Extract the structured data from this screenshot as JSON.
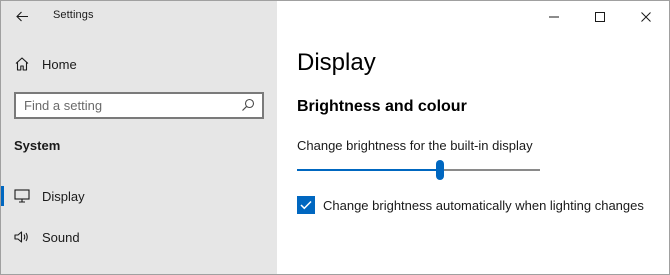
{
  "window": {
    "app_title": "Settings",
    "controls": [
      "minimize-icon",
      "maximize-icon",
      "close-icon"
    ]
  },
  "sidebar": {
    "home_label": "Home",
    "search": {
      "placeholder": "Find a setting",
      "value": "",
      "icon": "search-icon"
    },
    "section_label": "System",
    "items": [
      {
        "label": "Display",
        "icon": "monitor-icon",
        "selected": true
      },
      {
        "label": "Sound",
        "icon": "speaker-icon",
        "selected": false
      }
    ]
  },
  "main": {
    "title": "Display",
    "subheading": "Brightness and colour",
    "brightness": {
      "label": "Change brightness for the built-in display",
      "value_percent": 59
    },
    "auto_brightness": {
      "label": "Change brightness automatically when lighting changes",
      "checked": true
    }
  },
  "colors": {
    "accent": "#0067c0",
    "sidebar_bg": "#e6e6e6",
    "content_bg": "#ffffff"
  }
}
